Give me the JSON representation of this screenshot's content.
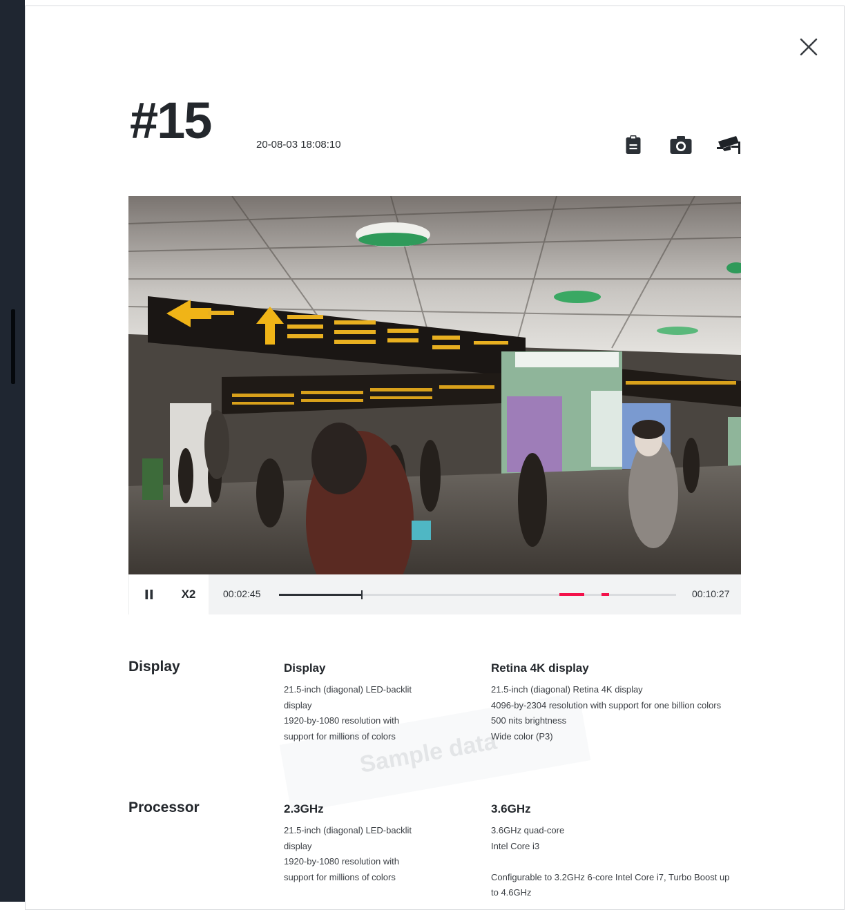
{
  "detail": {
    "title": "#15",
    "timestamp": "20-08-03 18:08:10",
    "actions": [
      {
        "name": "clipboard-icon"
      },
      {
        "name": "camera-icon"
      },
      {
        "name": "cctv-camera-icon"
      }
    ]
  },
  "player": {
    "speed_label": "X2",
    "current_time": "00:02:45",
    "total_time": "00:10:27",
    "progress": 0.209,
    "event_marks": [
      {
        "start": 0.706,
        "end": 0.768
      },
      {
        "start": 0.812,
        "end": 0.832
      }
    ],
    "state": "playing"
  },
  "specs": [
    {
      "section": "Display",
      "left": {
        "heading": "Display",
        "lines": [
          "21.5-inch (diagonal) LED-backlit",
          "display",
          "1920-by-1080 resolution with",
          "support for millions of colors"
        ]
      },
      "right": {
        "heading": "Retina 4K display",
        "lines": [
          "21.5-inch (diagonal) Retina 4K display",
          "4096-by-2304 resolution with support for one billion colors",
          "500 nits brightness",
          "Wide color (P3)"
        ]
      }
    },
    {
      "section": "Processor",
      "left": {
        "heading": "2.3GHz",
        "lines": [
          "21.5-inch (diagonal) LED-backlit",
          "display",
          "1920-by-1080 resolution with",
          "support for millions of colors"
        ]
      },
      "right": {
        "heading": "3.6GHz",
        "lines": [
          "3.6GHz quad-core",
          "Intel Core i3",
          "",
          "Configurable to 3.2GHz 6-core Intel Core i7, Turbo Boost up",
          "to 4.6GHz"
        ]
      }
    }
  ],
  "watermark_text": "Sample data",
  "colors": {
    "accent": "#f3114a",
    "backdrop": "#1f2631"
  }
}
